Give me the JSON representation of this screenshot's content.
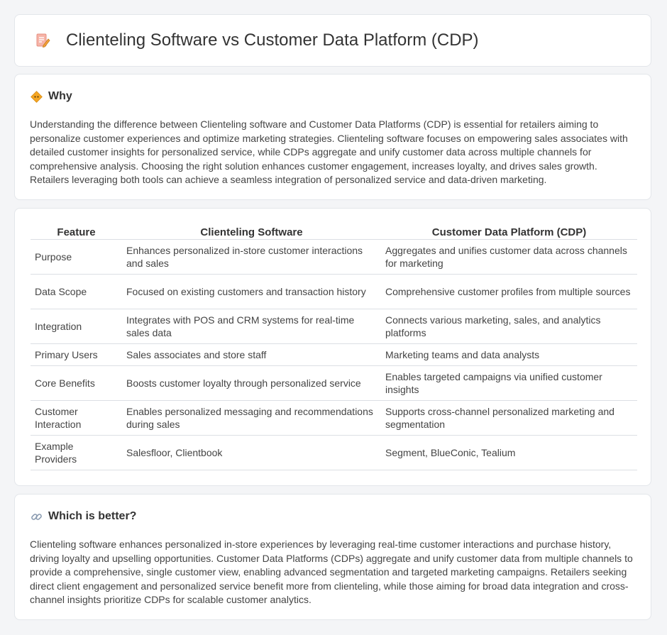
{
  "header": {
    "title": "Clienteling Software vs Customer Data Platform (CDP)",
    "icon": "document-pencil-icon"
  },
  "why": {
    "heading": "Why",
    "icon": "diamond-warning-icon",
    "text": "Understanding the difference between Clienteling software and Customer Data Platforms (CDP) is essential for retailers aiming to personalize customer experiences and optimize marketing strategies. Clienteling software focuses on empowering sales associates with detailed customer insights for personalized service, while CDPs aggregate and unify customer data across multiple channels for comprehensive analysis. Choosing the right solution enhances customer engagement, increases loyalty, and drives sales growth. Retailers leveraging both tools can achieve a seamless integration of personalized service and data-driven marketing."
  },
  "table": {
    "headers": [
      "Feature",
      "Clienteling Software",
      "Customer Data Platform (CDP)"
    ],
    "rows": [
      [
        "Purpose",
        "Enhances personalized in-store customer interactions and sales",
        "Aggregates and unifies customer data across channels for marketing"
      ],
      [
        "Data Scope",
        "Focused on existing customers and transaction history",
        "Comprehensive customer profiles from multiple sources"
      ],
      [
        "Integration",
        "Integrates with POS and CRM systems for real-time sales data",
        "Connects various marketing, sales, and analytics platforms"
      ],
      [
        "Primary Users",
        "Sales associates and store staff",
        "Marketing teams and data analysts"
      ],
      [
        "Core Benefits",
        "Boosts customer loyalty through personalized service",
        "Enables targeted campaigns via unified customer insights"
      ],
      [
        "Customer Interaction",
        "Enables personalized messaging and recommendations during sales",
        "Supports cross-channel personalized marketing and segmentation"
      ],
      [
        "Example Providers",
        "Salesfloor, Clientbook",
        "Segment, BlueConic, Tealium"
      ]
    ]
  },
  "better": {
    "heading": "Which is better?",
    "icon": "link-icon",
    "text": "Clienteling software enhances personalized in-store experiences by leveraging real-time customer interactions and purchase history, driving loyalty and upselling opportunities. Customer Data Platforms (CDPs) aggregate and unify customer data from multiple channels to provide a comprehensive, single customer view, enabling advanced segmentation and targeted marketing campaigns. Retailers seeking direct client engagement and personalized service benefit more from clienteling, while those aiming for broad data integration and cross-channel insights prioritize CDPs for scalable customer analytics."
  }
}
